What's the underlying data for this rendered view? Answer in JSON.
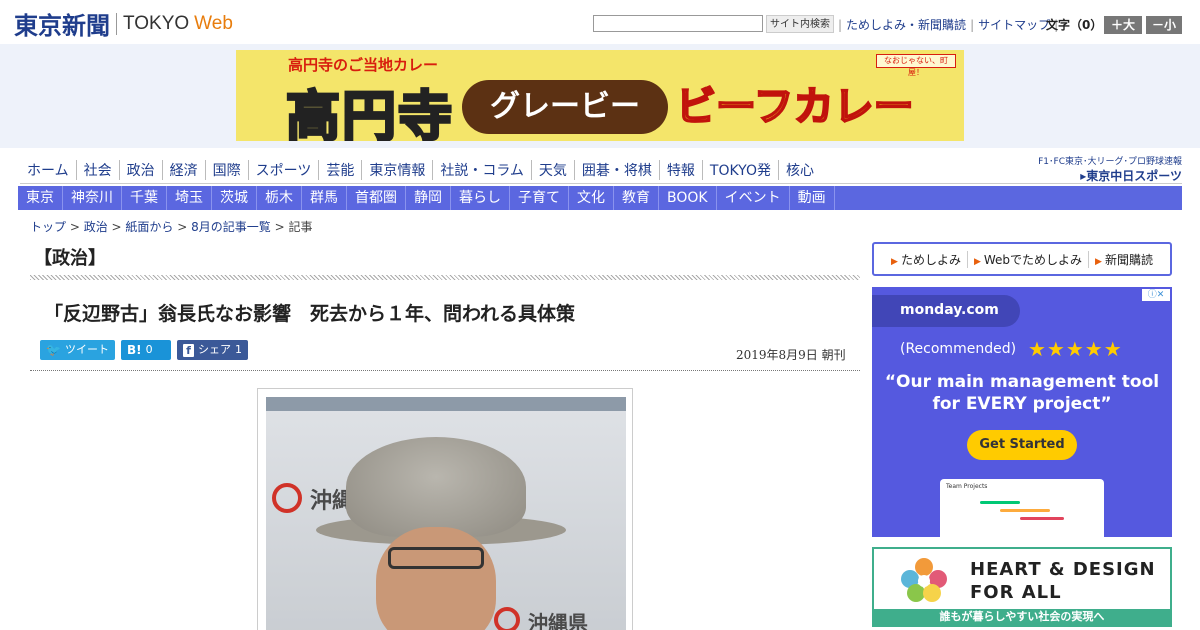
{
  "header": {
    "logo_jp": "東京新聞",
    "logo_en": "TOKYO",
    "logo_web": "Web",
    "search_button": "サイト内検索",
    "links": [
      "ためしよみ・新聞購読",
      "サイトマップ"
    ],
    "fontsize_label": "文字（0）",
    "font_larger": "＋大",
    "font_smaller": "－小"
  },
  "banner": {
    "subtitle": "高円寺のご当地カレー",
    "kanji": "高円寺",
    "pill": "グレービー",
    "curry": "ビーフカレー",
    "tag": "なおじゃない、町屋！"
  },
  "nav_primary": [
    "ホーム",
    "社会",
    "政治",
    "経済",
    "国際",
    "スポーツ",
    "芸能",
    "東京情報",
    "社説・コラム",
    "天気",
    "囲碁・将棋",
    "特報",
    "TOKYO発",
    "核心"
  ],
  "chunichi": {
    "top": "F1･FC東京･大リーグ･プロ野球速報",
    "bottom": "▸東京中日スポーツ"
  },
  "nav_regional": [
    "東京",
    "神奈川",
    "千葉",
    "埼玉",
    "茨城",
    "栃木",
    "群馬",
    "首都圏",
    "静岡",
    "暮らし",
    "子育て",
    "文化",
    "教育",
    "BOOK",
    "イベント",
    "動画"
  ],
  "breadcrumb": {
    "items": [
      "トップ",
      "政治",
      "紙面から",
      "8月の記事一覧"
    ],
    "current": "記事",
    "sep": " > "
  },
  "article": {
    "section": "【政治】",
    "headline": "「反辺野古」翁長氏なお影響　死去から１年、問われる具体策",
    "date": "2019年8月9日 朝刊",
    "share": {
      "tweet_icon": "🐦",
      "tweet_label": "ツイート",
      "hatena_icon": "B!",
      "hatena_count": "0",
      "fb_icon": "f",
      "fb_label": "シェア",
      "fb_count": "1"
    },
    "photo_text_1": "沖縄",
    "photo_text_2": "沖縄県"
  },
  "sidebar": {
    "links": [
      "ためしよみ",
      "Webでためしよみ",
      "新聞購読"
    ],
    "ad_monday": {
      "logo": "monday.com",
      "recommended": "(Recommended)",
      "stars": "★★★★★",
      "quote": "“Our main management tool for EVERY project”",
      "cta": "Get Started",
      "screenshot_title": "Team Projects"
    },
    "ad_heart": {
      "line1": "HEART & DESIGN",
      "line2": "FOR ALL",
      "footer": "誰もが暮らしやすい社会の実現へ"
    }
  },
  "colors": {
    "brand_blue": "#1f3d8c",
    "nav_bar": "#5b67e0",
    "web_orange": "#e87d0d",
    "monday_bg": "#5559df",
    "heart_green": "#3fae8c"
  }
}
